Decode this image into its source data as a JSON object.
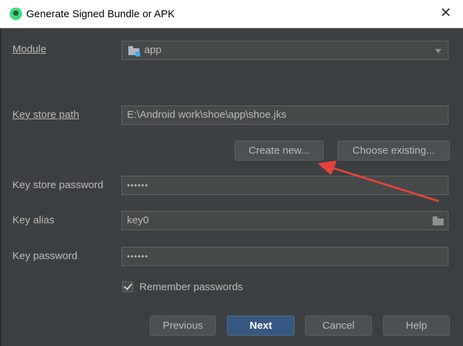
{
  "window": {
    "title": "Generate Signed Bundle or APK",
    "close_symbol": "✕"
  },
  "module": {
    "label": "Module",
    "value": "app"
  },
  "key_store_path": {
    "label": "Key store path",
    "value": "E:\\Android work\\shoe\\app\\shoe.jks"
  },
  "buttons": {
    "create_new": "Create new...",
    "choose_existing": "Choose existing..."
  },
  "key_store_password": {
    "label": "Key store password",
    "value": "••••••"
  },
  "key_alias": {
    "label": "Key alias",
    "value": "key0"
  },
  "key_password": {
    "label": "Key password",
    "value": "••••••"
  },
  "remember": {
    "label": "Remember passwords",
    "checked": true
  },
  "footer": {
    "previous": "Previous",
    "next": "Next",
    "cancel": "Cancel",
    "help": "Help"
  },
  "colors": {
    "dialog_bg": "#3c3f41",
    "field_bg": "#45494a",
    "default_button": "#365880",
    "annotation_arrow": "#e8413a"
  }
}
